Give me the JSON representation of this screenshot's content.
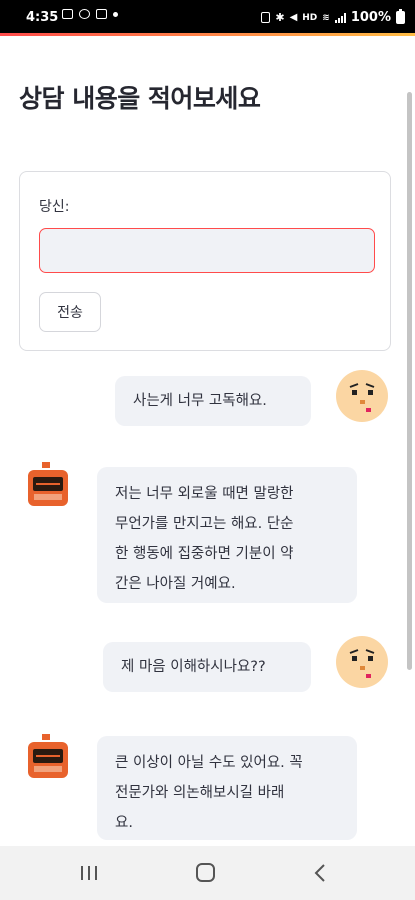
{
  "status_bar": {
    "time": "4:35",
    "battery": "100%"
  },
  "page": {
    "title": "상담 내용을 적어보세요"
  },
  "form": {
    "label": "당신:",
    "input_value": "",
    "send_label": "전송"
  },
  "chat": {
    "messages": [
      {
        "role": "user",
        "text": "사는게 너무 고독해요."
      },
      {
        "role": "bot",
        "lines": [
          "저는 너무 외로울 때면 말랑한",
          "무언가를 만지고는 해요. 단순",
          "한 행동에 집중하면 기분이 약",
          "간은 나아질 거예요."
        ]
      },
      {
        "role": "user",
        "text": "제 마음 이해하시나요??"
      },
      {
        "role": "bot",
        "lines": [
          "큰 이상이 아닐 수도 있어요. 꼭",
          "전문가와 의논해보시길 바래",
          "요."
        ]
      }
    ]
  },
  "colors": {
    "accent": "#ff4b4b",
    "bubble_bg": "#f0f2f6",
    "user_avatar": "#fbd6a3",
    "bot_avatar": "#e8622c"
  },
  "icons": {
    "user_avatar": "face-icon",
    "bot_avatar": "robot-icon"
  }
}
